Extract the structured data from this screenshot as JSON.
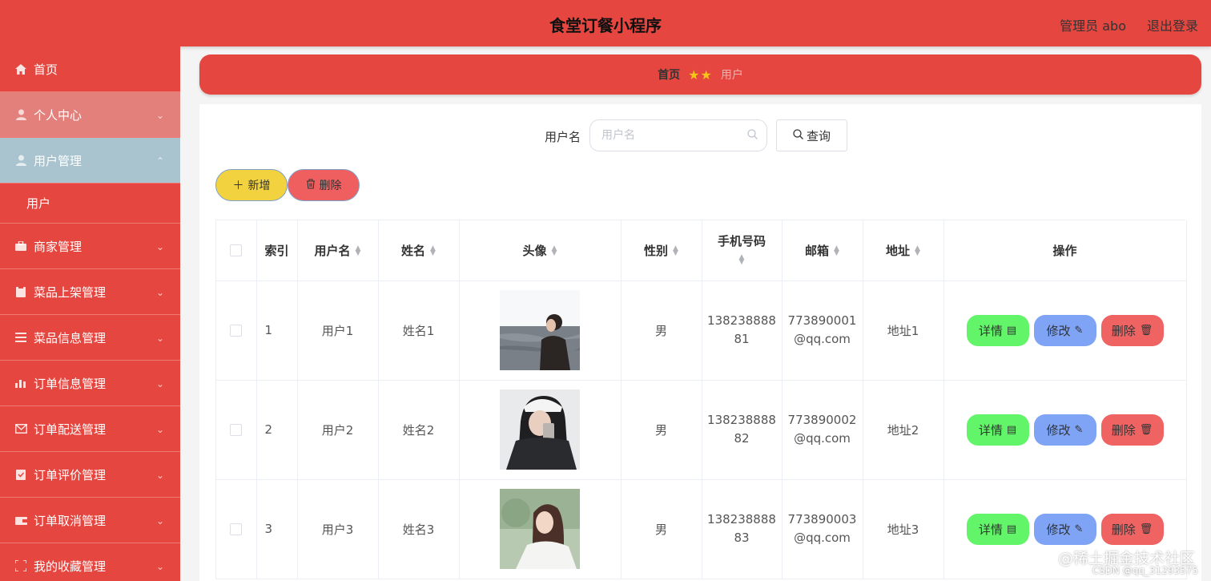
{
  "header": {
    "title": "食堂订餐小程序",
    "admin_label": "管理员 abo",
    "logout_label": "退出登录"
  },
  "sidebar": {
    "items": [
      {
        "label": "首页",
        "icon": "home-icon"
      },
      {
        "label": "个人中心",
        "icon": "person-icon"
      },
      {
        "label": "用户管理",
        "icon": "person-icon"
      },
      {
        "label": "商家管理",
        "icon": "briefcase-icon"
      },
      {
        "label": "菜品上架管理",
        "icon": "clipboard-icon"
      },
      {
        "label": "菜品信息管理",
        "icon": "list-icon"
      },
      {
        "label": "订单信息管理",
        "icon": "bar-chart-icon"
      },
      {
        "label": "订单配送管理",
        "icon": "mail-icon"
      },
      {
        "label": "订单评价管理",
        "icon": "checklist-icon"
      },
      {
        "label": "订单取消管理",
        "icon": "wallet-icon"
      },
      {
        "label": "我的收藏管理",
        "icon": "frame-icon"
      }
    ],
    "sub_item": "用户"
  },
  "breadcrumb": {
    "home": "首页",
    "current": "用户"
  },
  "search": {
    "label": "用户名",
    "placeholder": "用户名",
    "button": "查询"
  },
  "toolbar": {
    "add_label": "新增",
    "delete_label": "删除"
  },
  "table": {
    "headers": {
      "index": "索引",
      "username": "用户名",
      "name": "姓名",
      "avatar": "头像",
      "gender": "性别",
      "phone": "手机号码",
      "email": "邮箱",
      "address": "地址",
      "actions": "操作"
    },
    "rows": [
      {
        "index": "1",
        "username": "用户1",
        "name": "姓名1",
        "gender": "男",
        "phone_a": "138238888",
        "phone_b": "81",
        "email_a": "773890001",
        "email_b": "@qq.com",
        "address": "地址1"
      },
      {
        "index": "2",
        "username": "用户2",
        "name": "姓名2",
        "gender": "男",
        "phone_a": "138238888",
        "phone_b": "82",
        "email_a": "773890002",
        "email_b": "@qq.com",
        "address": "地址2"
      },
      {
        "index": "3",
        "username": "用户3",
        "name": "姓名3",
        "gender": "男",
        "phone_a": "138238888",
        "phone_b": "83",
        "email_a": "773890003",
        "email_b": "@qq.com",
        "address": "地址3"
      }
    ],
    "action_labels": {
      "detail": "详情",
      "edit": "修改",
      "delete": "删除"
    }
  },
  "watermark": {
    "line1": "@稀土掘金技术社区",
    "line2": "CSDN @qq_31293575"
  },
  "colors": {
    "primary": "#e5463f",
    "detail": "#62f56a",
    "edit": "#7fa4f5",
    "delete": "#f06363",
    "add": "#f2d33f"
  }
}
